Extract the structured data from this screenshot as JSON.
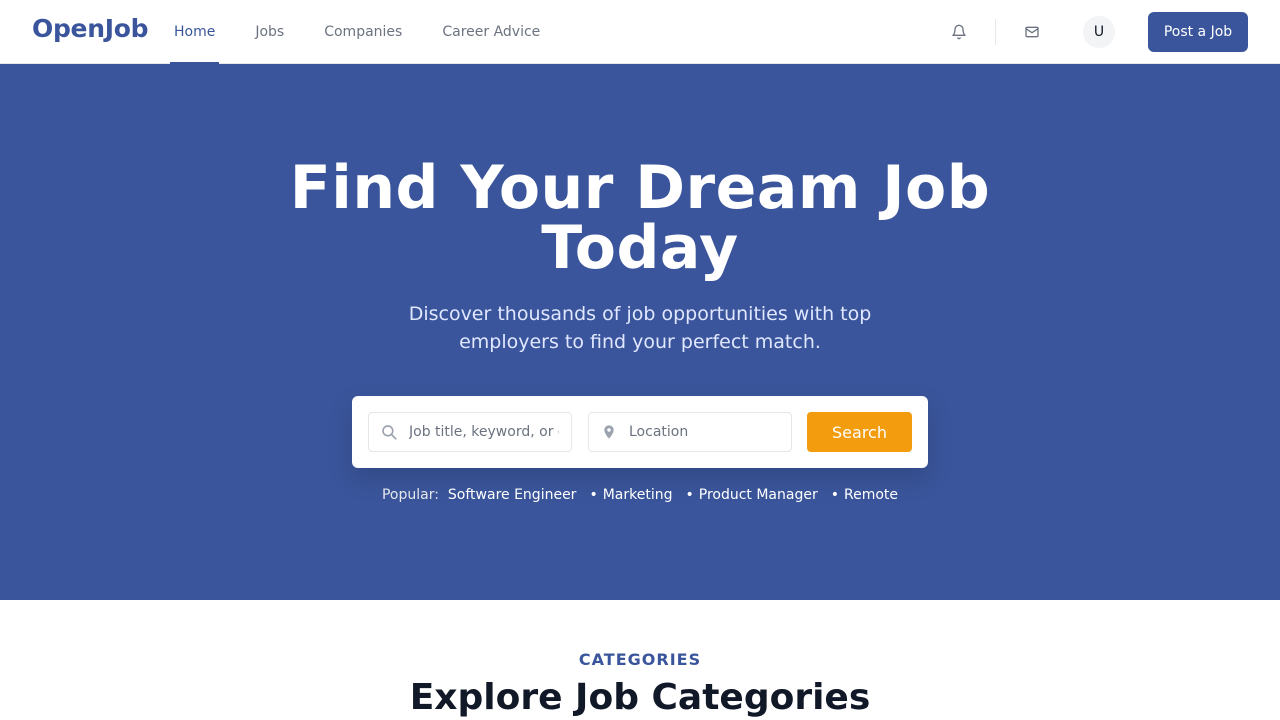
{
  "brand": {
    "name": "OpenJob",
    "color": "#3a559b"
  },
  "nav": {
    "links": [
      {
        "label": "Home",
        "active": true
      },
      {
        "label": "Jobs",
        "active": false
      },
      {
        "label": "Companies",
        "active": false
      },
      {
        "label": "Career Advice",
        "active": false
      }
    ],
    "icons": [
      "bell-icon",
      "mail-icon"
    ],
    "avatar_initial": "U",
    "post_job_label": "Post a Job"
  },
  "hero": {
    "title": "Find Your Dream Job Today",
    "subtitle": "Discover thousands of job opportunities with top employers to find your perfect match.",
    "background": "#3a559b",
    "search": {
      "keyword_placeholder": "Job title, keyword, or company",
      "keyword_value": "",
      "location_placeholder": "Location",
      "location_value": "",
      "button_label": "Search",
      "button_color": "#f29c0e"
    },
    "popular": {
      "label": "Popular:",
      "tags": [
        "Software Engineer",
        "Marketing",
        "Product Manager",
        "Remote"
      ]
    }
  },
  "categories": {
    "eyebrow": "CATEGORIES",
    "title": "Explore Job Categories"
  }
}
